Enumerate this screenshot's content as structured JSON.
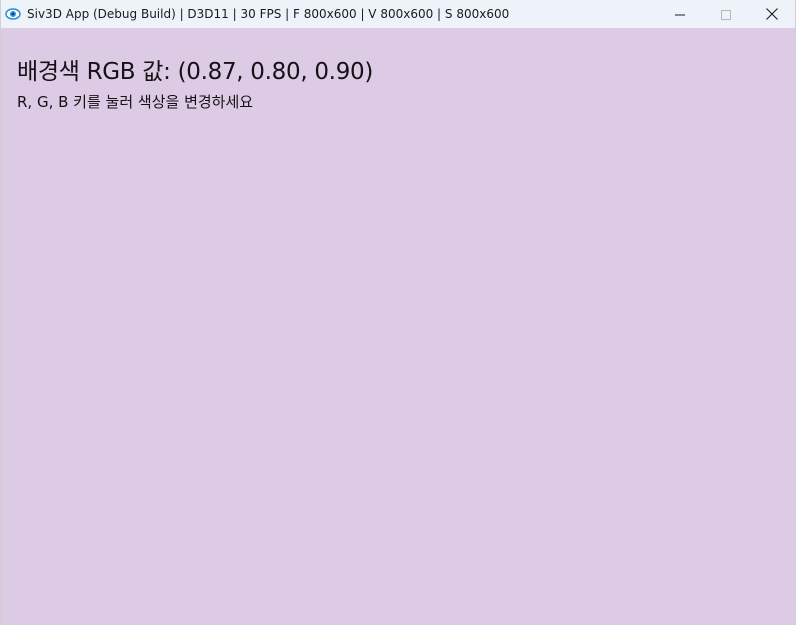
{
  "window": {
    "title": "Siv3D App (Debug Build) | D3D11 | 30 FPS | F 800x600 | V 800x600 | S 800x600",
    "app_icon": "siv3d-eye-icon",
    "controls": {
      "minimize_icon": "minimize-icon",
      "maximize_icon": "maximize-icon",
      "close_icon": "close-icon"
    }
  },
  "canvas": {
    "background_color": "#ddcbe5",
    "text_color": "#141214",
    "heading": "배경색 RGB 값: (0.87, 0.80, 0.90)",
    "hint": "R, G, B 키를 눌러 색상을 변경하세요"
  }
}
